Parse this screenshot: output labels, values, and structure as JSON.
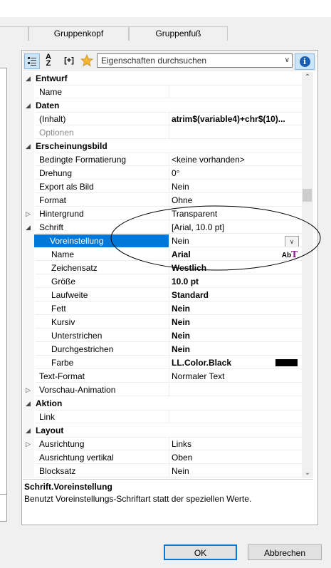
{
  "tabs": [
    {
      "label": ""
    },
    {
      "label": "Gruppenkopf"
    },
    {
      "label": "Gruppenfuß"
    }
  ],
  "toolbar": {
    "categorized_icon": "categorized-view-icon",
    "sort_icon": "sort-az-icon",
    "sort_top": "A",
    "sort_bottom": "Z",
    "expand_label": "[+]",
    "favorites_icon": "star-icon",
    "search_placeholder": "Eigenschaften durchsuchen",
    "info_icon": "info-icon",
    "info_label": "i"
  },
  "properties": [
    {
      "kind": "cat",
      "expand": "◢",
      "label": "Entwurf"
    },
    {
      "kind": "prop",
      "level": 1,
      "label": "Name",
      "value": ""
    },
    {
      "kind": "cat",
      "expand": "◢",
      "label": "Daten"
    },
    {
      "kind": "prop",
      "level": 1,
      "label": "(Inhalt)",
      "value": "atrim$(variable4)+chr$(10)...",
      "bold": true
    },
    {
      "kind": "prop",
      "level": 1,
      "label": "Optionen",
      "value": "",
      "disabled": true
    },
    {
      "kind": "cat",
      "expand": "◢",
      "label": "Erscheinungsbild"
    },
    {
      "kind": "prop",
      "level": 1,
      "label": "Bedingte Formatierung",
      "value": "<keine vorhanden>"
    },
    {
      "kind": "prop",
      "level": 1,
      "label": "Drehung",
      "value": "0°"
    },
    {
      "kind": "prop",
      "level": 1,
      "label": "Export als Bild",
      "value": "Nein"
    },
    {
      "kind": "prop",
      "level": 1,
      "label": "Format",
      "value": "Ohne"
    },
    {
      "kind": "prop",
      "level": 1,
      "expand": "▷",
      "label": "Hintergrund",
      "value": "Transparent"
    },
    {
      "kind": "prop",
      "level": 1,
      "expand": "◢",
      "label": "Schrift",
      "value": "[Arial, 10.0 pt]"
    },
    {
      "kind": "prop",
      "level": 2,
      "label": "Voreinstellung",
      "value": "Nein",
      "selected": true,
      "dropdown": true
    },
    {
      "kind": "prop",
      "level": 2,
      "label": "Name",
      "value": "Arial",
      "bold": true,
      "font_glyph": true
    },
    {
      "kind": "prop",
      "level": 2,
      "label": "Zeichensatz",
      "value": "Westlich",
      "bold": true
    },
    {
      "kind": "prop",
      "level": 2,
      "label": "Größe",
      "value": "10.0 pt",
      "bold": true
    },
    {
      "kind": "prop",
      "level": 2,
      "label": "Laufweite",
      "value": "Standard",
      "bold": true
    },
    {
      "kind": "prop",
      "level": 2,
      "label": "Fett",
      "value": "Nein",
      "bold": true
    },
    {
      "kind": "prop",
      "level": 2,
      "label": "Kursiv",
      "value": "Nein",
      "bold": true
    },
    {
      "kind": "prop",
      "level": 2,
      "label": "Unterstrichen",
      "value": "Nein",
      "bold": true
    },
    {
      "kind": "prop",
      "level": 2,
      "label": "Durchgestrichen",
      "value": "Nein",
      "bold": true
    },
    {
      "kind": "prop",
      "level": 2,
      "label": "Farbe",
      "value": "LL.Color.Black",
      "bold": true,
      "swatch": "#000000"
    },
    {
      "kind": "prop",
      "level": 1,
      "label": "Text-Format",
      "value": "Normaler Text"
    },
    {
      "kind": "prop",
      "level": 1,
      "expand": "▷",
      "label": "Vorschau-Animation",
      "value": ""
    },
    {
      "kind": "cat",
      "expand": "◢",
      "label": "Aktion"
    },
    {
      "kind": "prop",
      "level": 1,
      "label": "Link",
      "value": ""
    },
    {
      "kind": "cat",
      "expand": "◢",
      "label": "Layout"
    },
    {
      "kind": "prop",
      "level": 1,
      "expand": "▷",
      "label": "Ausrichtung",
      "value": "Links"
    },
    {
      "kind": "prop",
      "level": 1,
      "label": "Ausrichtung vertikal",
      "value": "Oben"
    },
    {
      "kind": "prop",
      "level": 1,
      "label": "Blocksatz",
      "value": "Nein"
    }
  ],
  "font_glyph": {
    "ab": "Ab",
    "t": "T"
  },
  "scroll": {
    "up": "⌃",
    "down": "⌄"
  },
  "description": {
    "title": "Schrift.Voreinstellung",
    "text": "Benutzt Voreinstellungs-Schriftart statt der speziellen Werte."
  },
  "buttons": {
    "ok": "OK",
    "cancel": "Abbrechen"
  },
  "colors": {
    "selection": "#0078d7",
    "accent": "#0078d7",
    "annotation": "#000000"
  }
}
